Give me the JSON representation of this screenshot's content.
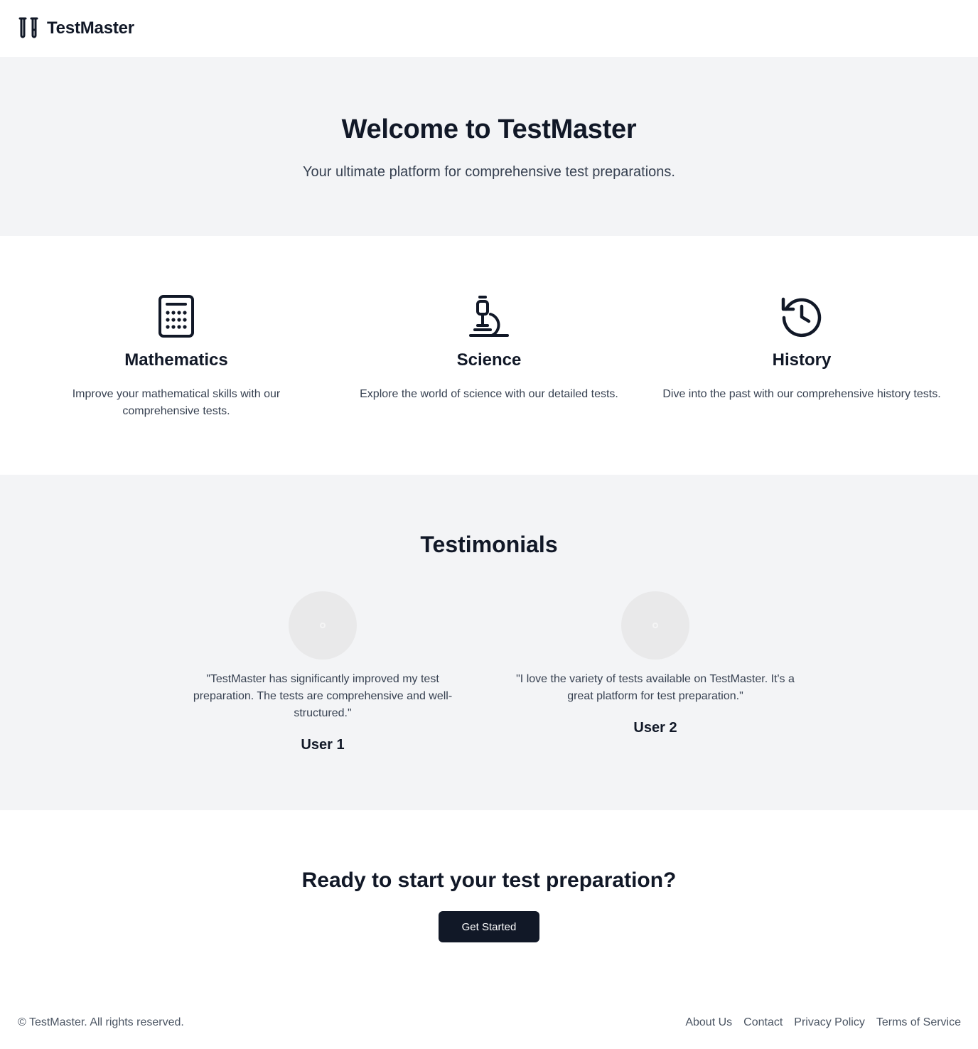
{
  "header": {
    "brand": "TestMaster",
    "logo_icon": "test-tubes-icon"
  },
  "hero": {
    "title": "Welcome to TestMaster",
    "subtitle": "Your ultimate platform for comprehensive test preparations."
  },
  "features": [
    {
      "icon": "calculator-icon",
      "title": "Mathematics",
      "description": "Improve your mathematical skills with our comprehensive tests."
    },
    {
      "icon": "microscope-icon",
      "title": "Science",
      "description": "Explore the world of science with our detailed tests."
    },
    {
      "icon": "history-icon",
      "title": "History",
      "description": "Dive into the past with our comprehensive history tests."
    }
  ],
  "testimonials": {
    "title": "Testimonials",
    "items": [
      {
        "quote": "\"TestMaster has significantly improved my test preparation. The tests are comprehensive and well-structured.\"",
        "name": "User 1"
      },
      {
        "quote": "\"I love the variety of tests available on TestMaster. It's a great platform for test preparation.\"",
        "name": "User 2"
      }
    ]
  },
  "cta": {
    "title": "Ready to start your test preparation?",
    "button_label": "Get Started"
  },
  "footer": {
    "copyright": "© TestMaster. All rights reserved.",
    "links": [
      "About Us",
      "Contact",
      "Privacy Policy",
      "Terms of Service"
    ]
  },
  "colors": {
    "text": "#111827",
    "muted": "#374151",
    "section_bg": "#f3f4f6",
    "button_bg": "#111827",
    "avatar_bg": "#e9e9ea"
  }
}
